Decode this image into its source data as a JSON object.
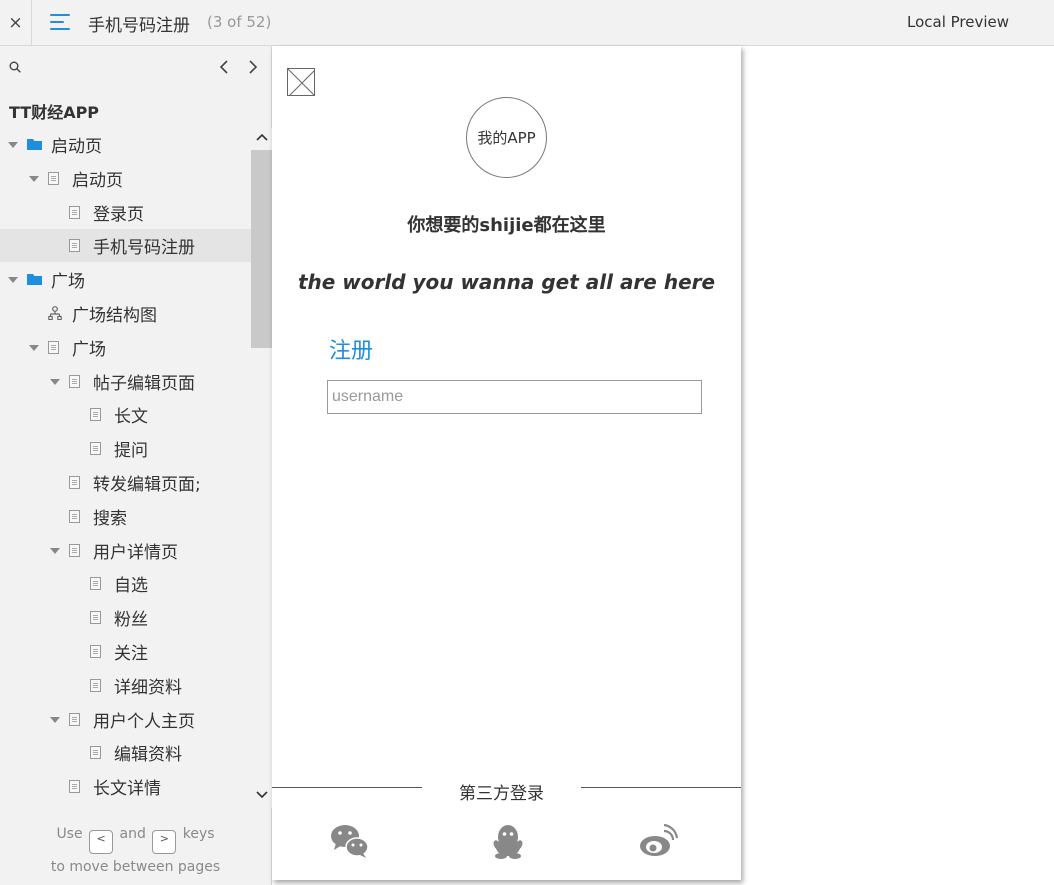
{
  "topbar": {
    "close_glyph": "×",
    "menu_icon": "menu-icon",
    "title": "手机号码注册",
    "page_count": "(3 of 52)",
    "local_preview": "Local Preview"
  },
  "sidebar": {
    "search_icon": "search-icon",
    "prev_glyph": "‹",
    "next_glyph": "›",
    "project_title": "TT财经APP",
    "items": [
      {
        "label": "启动页",
        "type": "folder",
        "level": 0,
        "expanded": true,
        "selected": false
      },
      {
        "label": "启动页",
        "type": "page",
        "level": 1,
        "expanded": true,
        "selected": false
      },
      {
        "label": "登录页",
        "type": "page",
        "level": 2,
        "expanded": false,
        "selected": false
      },
      {
        "label": "手机号码注册",
        "type": "page",
        "level": 2,
        "expanded": false,
        "selected": true
      },
      {
        "label": "广场",
        "type": "folder",
        "level": 0,
        "expanded": true,
        "selected": false
      },
      {
        "label": "广场结构图",
        "type": "flow",
        "level": 1,
        "expanded": false,
        "selected": false
      },
      {
        "label": "广场",
        "type": "page",
        "level": 1,
        "expanded": true,
        "selected": false
      },
      {
        "label": "帖子编辑页面",
        "type": "page",
        "level": 2,
        "expanded": true,
        "selected": false
      },
      {
        "label": "长文",
        "type": "page",
        "level": 3,
        "expanded": false,
        "selected": false
      },
      {
        "label": "提问",
        "type": "page",
        "level": 3,
        "expanded": false,
        "selected": false
      },
      {
        "label": "转发编辑页面;",
        "type": "page",
        "level": 2,
        "expanded": false,
        "selected": false
      },
      {
        "label": "搜索",
        "type": "page",
        "level": 2,
        "expanded": false,
        "selected": false
      },
      {
        "label": "用户详情页",
        "type": "page",
        "level": 2,
        "expanded": true,
        "selected": false
      },
      {
        "label": "自选",
        "type": "page",
        "level": 3,
        "expanded": false,
        "selected": false
      },
      {
        "label": "粉丝",
        "type": "page",
        "level": 3,
        "expanded": false,
        "selected": false
      },
      {
        "label": "关注",
        "type": "page",
        "level": 3,
        "expanded": false,
        "selected": false
      },
      {
        "label": "详细资料",
        "type": "page",
        "level": 3,
        "expanded": false,
        "selected": false
      },
      {
        "label": "用户个人主页",
        "type": "page",
        "level": 2,
        "expanded": true,
        "selected": false
      },
      {
        "label": "编辑资料",
        "type": "page",
        "level": 3,
        "expanded": false,
        "selected": false
      },
      {
        "label": "长文详情",
        "type": "page",
        "level": 2,
        "expanded": false,
        "selected": false
      }
    ],
    "hint": {
      "use": "Use",
      "prev_key": "<",
      "and": "and",
      "next_key": ">",
      "keys": "keys",
      "line2": "to move between pages"
    }
  },
  "phone": {
    "image_placeholder_icon": "image-placeholder-icon",
    "app_logo_text": "我的APP",
    "tagline_cn": "你想要的shijie都在这里",
    "tagline_en": "the world you wanna get all are here",
    "register_heading": "注册",
    "username_placeholder": "username",
    "username_value": "",
    "third_party_label": "第三方登录",
    "social_icons": [
      "wechat-icon",
      "qq-icon",
      "weibo-icon"
    ]
  },
  "colors": {
    "accent": "#1e8ede",
    "folder": "#1e8ede",
    "sidebar_bg": "#f2f2f2",
    "selected_bg": "#e4e4e4",
    "social_icon": "#888888"
  }
}
